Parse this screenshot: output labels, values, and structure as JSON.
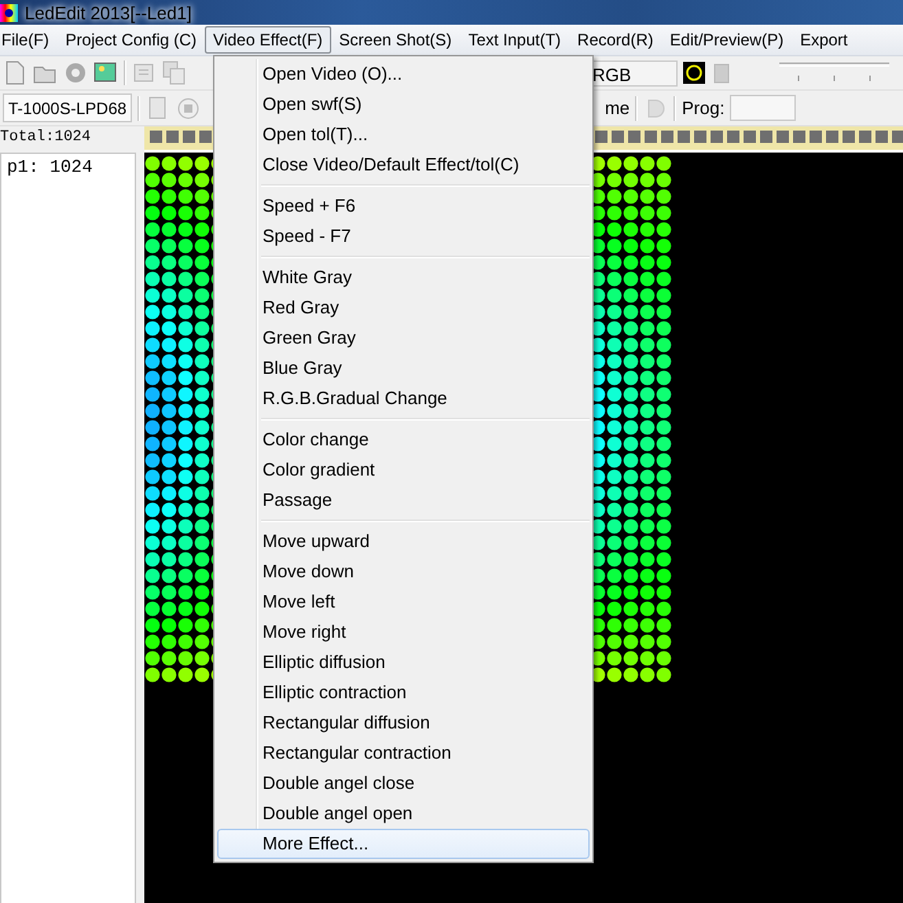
{
  "window": {
    "title": "LedEdit 2013[--Led1]"
  },
  "menu_bar": [
    {
      "label": "File(F)",
      "selected": false
    },
    {
      "label": "Project Config (C)",
      "selected": false
    },
    {
      "label": "Video Effect(F)",
      "selected": true
    },
    {
      "label": "Screen Shot(S)",
      "selected": false
    },
    {
      "label": "Text Input(T)",
      "selected": false
    },
    {
      "label": "Record(R)",
      "selected": false
    },
    {
      "label": "Edit/Preview(P)",
      "selected": false
    },
    {
      "label": "Export",
      "selected": false
    }
  ],
  "toolbar": {
    "color_order": "RGB"
  },
  "toolbar_2": {
    "controller": "T-1000S-LPD68",
    "frame_label": "me",
    "prog_label": "Prog:"
  },
  "total": "Total:1024",
  "program_list": [
    {
      "label": "p1: 1024"
    }
  ],
  "dropdown_menu": [
    [
      {
        "label": "Open Video (O)...",
        "selected": false
      },
      {
        "label": "Open swf(S)",
        "selected": false
      },
      {
        "label": "Open tol(T)...",
        "selected": false
      },
      {
        "label": "Close Video/Default Effect/tol(C)",
        "selected": false
      }
    ],
    [
      {
        "label": "Speed +  F6",
        "selected": false
      },
      {
        "label": "Speed -  F7",
        "selected": false
      }
    ],
    [
      {
        "label": "White Gray",
        "selected": false
      },
      {
        "label": "Red Gray",
        "selected": false
      },
      {
        "label": "Green Gray",
        "selected": false
      },
      {
        "label": "Blue Gray",
        "selected": false
      },
      {
        "label": "R.G.B.Gradual Change",
        "selected": false
      }
    ],
    [
      {
        "label": "Color change",
        "selected": false
      },
      {
        "label": "Color gradient",
        "selected": false
      },
      {
        "label": "Passage",
        "selected": false
      }
    ],
    [
      {
        "label": "Move upward",
        "selected": false
      },
      {
        "label": "Move down",
        "selected": false
      },
      {
        "label": "Move left",
        "selected": false
      },
      {
        "label": "Move right",
        "selected": false
      },
      {
        "label": "Elliptic diffusion",
        "selected": false
      },
      {
        "label": "Elliptic contraction",
        "selected": false
      },
      {
        "label": "Rectangular diffusion",
        "selected": false
      },
      {
        "label": "Rectangular contraction",
        "selected": false
      },
      {
        "label": "Double angel close",
        "selected": false
      },
      {
        "label": "Double angel open",
        "selected": false
      },
      {
        "label": "More Effect...",
        "selected": true
      }
    ]
  ]
}
